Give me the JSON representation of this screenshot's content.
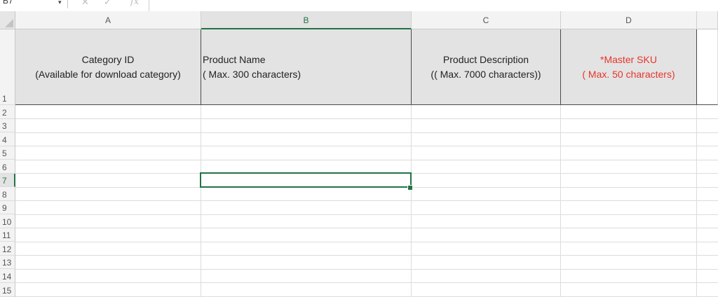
{
  "formula_bar": {
    "name_box_value": "B7",
    "dropdown_glyph": "▾",
    "cancel_glyph": "✕",
    "confirm_glyph": "✓",
    "fx_label": "fx"
  },
  "columns": [
    {
      "letter": "A"
    },
    {
      "letter": "B"
    },
    {
      "letter": "C"
    },
    {
      "letter": "D"
    }
  ],
  "rows": [
    "1",
    "2",
    "3",
    "4",
    "5",
    "6",
    "7",
    "8",
    "9",
    "10",
    "11",
    "12",
    "13",
    "14",
    "15"
  ],
  "header_row": {
    "A": {
      "line1": "Category ID",
      "line2": "(Available for download category)"
    },
    "B": {
      "line1": "Product Name",
      "line2": "( Max. 300 characters)"
    },
    "C": {
      "line1": "Product Description",
      "line2": "(( Max. 7000 characters))"
    },
    "D": {
      "line1": "*Master SKU",
      "line2": "( Max. 50 characters)"
    }
  },
  "selected_cell": "B7",
  "colors": {
    "accent_green": "#217346",
    "required_red": "#e8342a",
    "header_fill": "#e3e3e3"
  }
}
